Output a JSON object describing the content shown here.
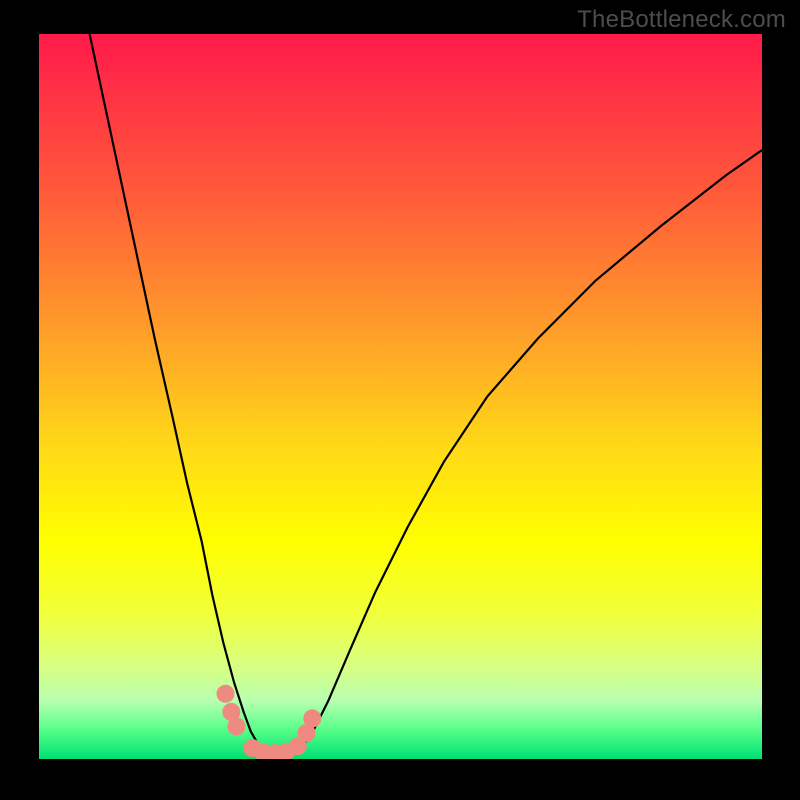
{
  "watermark": "TheBottleneck.com",
  "colors": {
    "bg": "#000000",
    "gradient_top": "#ff1a4a",
    "gradient_bottom": "#00e072",
    "curve": "#000000",
    "markers": "#ef8a80"
  },
  "chart_data": {
    "type": "line",
    "title": "",
    "xlabel": "",
    "ylabel": "",
    "xlim": [
      0,
      100
    ],
    "ylim": [
      0,
      100
    ],
    "note": "No axis ticks or numeric labels are visible. Values below encode the visible curve geometry: x is 0–100 left→right across the gradient plot area, y is 0–100 bottom→top.",
    "series": [
      {
        "name": "curve",
        "x": [
          7.0,
          10.0,
          13.0,
          16.0,
          18.5,
          20.5,
          22.5,
          24.0,
          25.5,
          27.0,
          28.3,
          29.3,
          30.5,
          31.5,
          33.0,
          34.5,
          36.3,
          38.0,
          40.0,
          43.0,
          46.5,
          51.0,
          56.0,
          62.0,
          69.0,
          77.0,
          86.0,
          95.0,
          100.0
        ],
        "y": [
          100.0,
          86.0,
          72.0,
          58.0,
          47.0,
          38.0,
          30.0,
          22.5,
          16.0,
          10.5,
          6.5,
          3.8,
          1.7,
          0.8,
          0.3,
          0.4,
          1.5,
          4.0,
          8.0,
          15.0,
          23.0,
          32.0,
          41.0,
          50.0,
          58.0,
          66.0,
          73.5,
          80.5,
          84.0
        ]
      }
    ],
    "markers": {
      "name": "highlight-dots",
      "x": [
        25.8,
        26.6,
        27.3,
        29.5,
        31.0,
        32.6,
        34.2,
        35.8,
        37.0,
        37.8
      ],
      "y": [
        9.0,
        6.5,
        4.5,
        1.5,
        0.9,
        0.8,
        1.0,
        1.8,
        3.6,
        5.6
      ]
    }
  }
}
